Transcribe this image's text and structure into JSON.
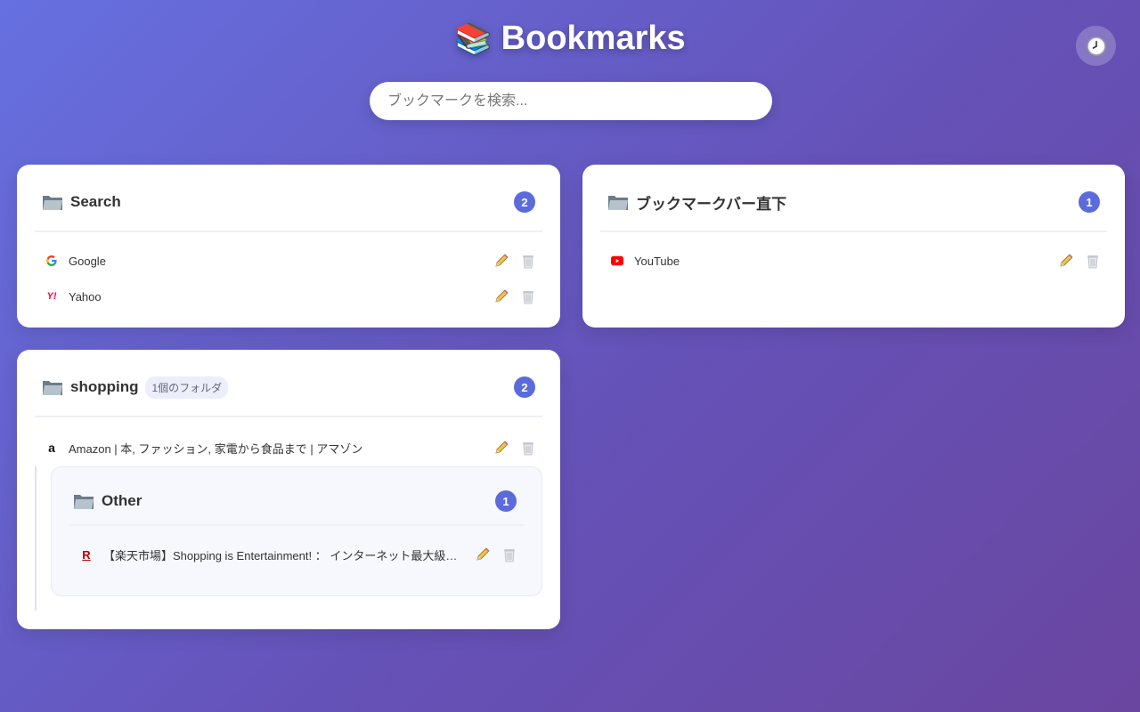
{
  "header": {
    "emoji": "📚",
    "title": "Bookmarks"
  },
  "search": {
    "placeholder": "ブックマークを検索...",
    "value": ""
  },
  "folders": [
    {
      "name": "Search",
      "count": "2",
      "bookmarks": [
        {
          "title": "Google",
          "favicon": "google-icon"
        },
        {
          "title": "Yahoo",
          "favicon": "yahoo-icon"
        }
      ]
    },
    {
      "name": "ブックマークバー直下",
      "count": "1",
      "bookmarks": [
        {
          "title": "YouTube",
          "favicon": "youtube-icon"
        }
      ]
    },
    {
      "name": "shopping",
      "subfolders_label": "1個のフォルダ",
      "count": "2",
      "bookmarks": [
        {
          "title": "Amazon | 本, ファッション, 家電から食品まで | アマゾン",
          "favicon": "amazon-icon"
        }
      ],
      "subfolders": [
        {
          "name": "Other",
          "count": "1",
          "bookmarks": [
            {
              "title": "【楽天市場】Shopping is Entertainment! ： インターネット最大級の通…",
              "favicon": "rakuten-icon"
            }
          ]
        }
      ]
    }
  ],
  "colors": {
    "accent": "#5b6bdc",
    "bg_start": "#6670e0",
    "bg_end": "#6a46a0"
  }
}
